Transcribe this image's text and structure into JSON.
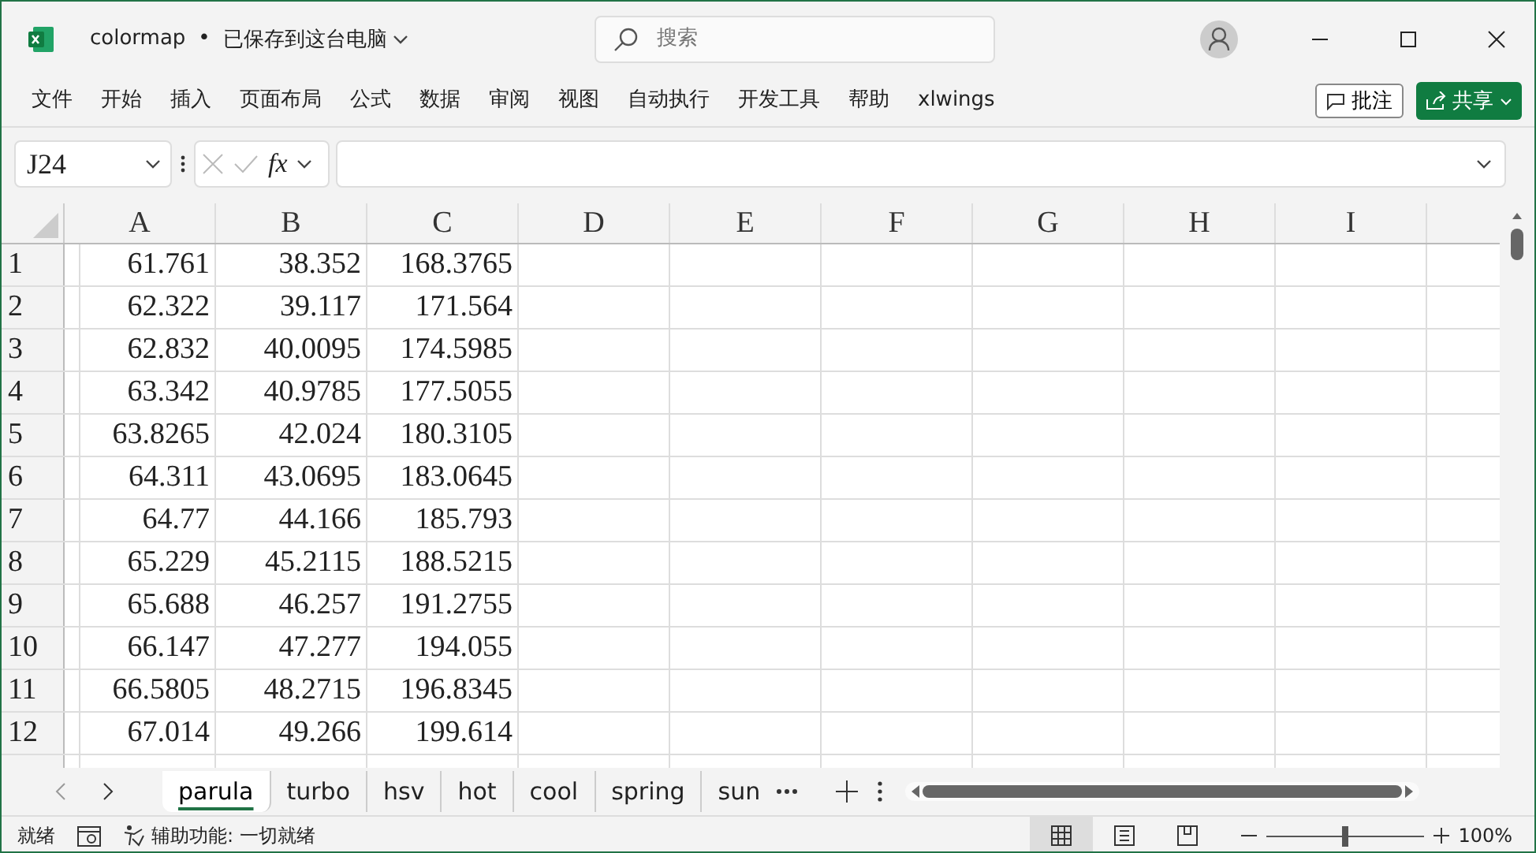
{
  "window": {
    "title": "colormap",
    "separator": "•",
    "save_status": "已保存到这台电脑",
    "search": {
      "placeholder": "搜索"
    }
  },
  "ribbon_tabs": [
    {
      "label": "文件",
      "selected": false
    },
    {
      "label": "开始",
      "selected": false
    },
    {
      "label": "插入",
      "selected": false
    },
    {
      "label": "页面布局",
      "selected": false
    },
    {
      "label": "公式",
      "selected": false
    },
    {
      "label": "数据",
      "selected": false
    },
    {
      "label": "审阅",
      "selected": false
    },
    {
      "label": "视图",
      "selected": false
    },
    {
      "label": "自动执行",
      "selected": false
    },
    {
      "label": "开发工具",
      "selected": false
    },
    {
      "label": "帮助",
      "selected": false
    },
    {
      "label": "xlwings",
      "selected": false
    }
  ],
  "ribbon_buttons": {
    "comments": "批注",
    "share": "共享"
  },
  "formula_bar": {
    "name_box": "J24",
    "fx": "fx"
  },
  "sheet": {
    "columns": [
      "A",
      "B",
      "C",
      "D",
      "E",
      "F",
      "G",
      "H",
      "I"
    ],
    "rows": [
      {
        "number": "1",
        "cells": [
          "61.761",
          "38.352",
          "168.3765"
        ]
      },
      {
        "number": "2",
        "cells": [
          "62.322",
          "39.117",
          "171.564"
        ]
      },
      {
        "number": "3",
        "cells": [
          "62.832",
          "40.0095",
          "174.5985"
        ]
      },
      {
        "number": "4",
        "cells": [
          "63.342",
          "40.9785",
          "177.5055"
        ]
      },
      {
        "number": "5",
        "cells": [
          "63.8265",
          "42.024",
          "180.3105"
        ]
      },
      {
        "number": "6",
        "cells": [
          "64.311",
          "43.0695",
          "183.0645"
        ]
      },
      {
        "number": "7",
        "cells": [
          "64.77",
          "44.166",
          "185.793"
        ]
      },
      {
        "number": "8",
        "cells": [
          "65.229",
          "45.2115",
          "188.5215"
        ]
      },
      {
        "number": "9",
        "cells": [
          "65.688",
          "46.257",
          "191.2755"
        ]
      },
      {
        "number": "10",
        "cells": [
          "66.147",
          "47.277",
          "194.055"
        ]
      },
      {
        "number": "11",
        "cells": [
          "66.5805",
          "48.2715",
          "196.8345"
        ]
      },
      {
        "number": "12",
        "cells": [
          "67.014",
          "49.266",
          "199.614"
        ]
      }
    ]
  },
  "sheet_tabs": [
    {
      "label": "parula",
      "selected": true
    },
    {
      "label": "turbo",
      "selected": false
    },
    {
      "label": "hsv",
      "selected": false
    },
    {
      "label": "hot",
      "selected": false
    },
    {
      "label": "cool",
      "selected": false
    },
    {
      "label": "spring",
      "selected": false
    },
    {
      "label": "sun",
      "selected": false
    }
  ],
  "status_bar": {
    "mode": "就绪",
    "accessibility": "辅助功能: 一切就绪",
    "views": [
      {
        "kind": "normal",
        "selected": true
      },
      {
        "kind": "page_layout",
        "selected": false
      },
      {
        "kind": "page_break",
        "selected": false
      }
    ],
    "zoom": {
      "level": 0.5,
      "reading": "100%"
    }
  }
}
